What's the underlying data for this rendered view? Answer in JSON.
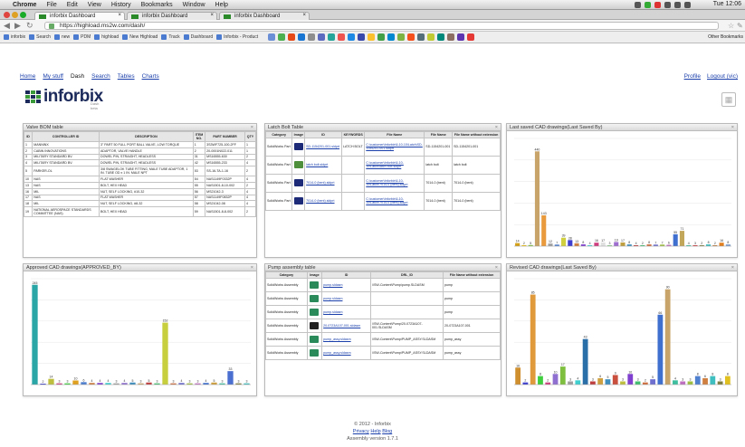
{
  "menubar": {
    "app": "Chrome",
    "items": [
      "File",
      "Edit",
      "View",
      "History",
      "Bookmarks",
      "Window",
      "Help"
    ],
    "clock": "Tue 12:06"
  },
  "tabs": [
    {
      "title": "inforbix Dashboard"
    },
    {
      "title": "inforbix Dashboard"
    },
    {
      "title": "inforbix Dashboard"
    }
  ],
  "address": {
    "url": "https://highload.ms2w.com/dash/"
  },
  "bookmarks": [
    {
      "label": "inforbix"
    },
    {
      "label": "Search"
    },
    {
      "label": "new"
    },
    {
      "label": "PDM"
    },
    {
      "label": "highload"
    },
    {
      "label": "New Highload"
    },
    {
      "label": "Track"
    },
    {
      "label": "Dashboard"
    },
    {
      "label": "Inforbix - Product"
    }
  ],
  "bookmarks_right": "Other Bookmarks",
  "nav": {
    "items": [
      "Home",
      "My stuff",
      "Dash",
      "Search",
      "Tables",
      "Charts"
    ],
    "current": 2,
    "right": [
      "Profile",
      "Logout (vic)"
    ]
  },
  "brand": {
    "name": "inforbix",
    "sub": "Dash beta"
  },
  "panels": {
    "valve": {
      "title": "Valve BOM table",
      "columns": [
        "ID",
        "CONTROLLER ID",
        "DESCRIPTION",
        "ITEM NO.",
        "PART NUMBER",
        "QTY"
      ],
      "rows": [
        [
          "1",
          "MANNINX",
          "3\" PART 50 FULL PORT BALL VALVE, LOW TORQUE",
          "1",
          "3S3WF725-100-2FF",
          "1"
        ],
        [
          "2",
          "CABIN INNOVATIONS",
          "ADAPTOR, VALVE HANDLE",
          "2",
          "20-0001N022-011",
          "1"
        ],
        [
          "3",
          "MILITARY STANDARD BV.",
          "DOWEL PIN, STRAIGHT, HEADLESS",
          "31",
          "MS16555-630",
          "2"
        ],
        [
          "4",
          "MILITARY STANDARD BV.",
          "DOWEL PIN, STRAIGHT, HEADLESS",
          "42",
          "MS16555-233",
          "4"
        ],
        [
          "5",
          "PARKER-OL",
          "3/8 SWAGELOK TUBE FITTING, MALE TUBE ADAPTOR, 1 IN. TUBE OD x 1 IN. MALE NPT",
          "53",
          "SS-16-TA-1-16",
          "2"
        ],
        [
          "10",
          "NAS",
          "FLAT WASHER",
          "54",
          "NAS1149F0332P",
          "4"
        ],
        [
          "13",
          "NAS",
          "BOLT, HEX HEAD",
          "55",
          "NAS1501-8-10-002",
          "2"
        ],
        [
          "16",
          "MIL",
          "NUT, SELF LOCKING, #10-32",
          "56",
          "MS21042-3",
          "4"
        ],
        [
          "17",
          "NAS",
          "FLAT WASHER",
          "57",
          "NAS1149F0832P",
          "4"
        ],
        [
          "18",
          "MIL",
          "NUT, SELF LOCKING, #8-32",
          "58",
          "MS21042-08",
          "4"
        ],
        [
          "19",
          "NATIONAL AEROSPACE STANDARDS COMMITTEE (NAS)",
          "BOLT, HEX HEAD",
          "59",
          "NAS1501-8-8-002",
          "2"
        ]
      ]
    },
    "latch": {
      "title": "Latch Bolt Table",
      "columns": [
        "Category",
        "Image",
        "ID",
        "KEYWORDS",
        "File Name",
        "File Name",
        "File Name without extension"
      ],
      "rows": [
        [
          "SolidWorks Part",
          "latch-bolt",
          "SD-1154201-001.sldprt",
          "LATCH BOLT",
          "C:\\customer\\Inforbix\\6-10-10\\Latch\\SD-1154201-001.sldprt",
          "SD-1154201-001",
          "SD-1154201-001"
        ],
        [
          "SolidWorks Part",
          "latch-bolt",
          "latch bolt.sldprt",
          "",
          "C:\\customer\\Inforbix\\6-10-10\\Latch\\latch bolt.sldprt",
          "latch bolt",
          "latch bolt"
        ],
        [
          "SolidWorks Part",
          "latch-bolt",
          "7014-0 (bent).sldprt",
          "",
          "C:\\customer\\Inforbix\\6-10-10\\Latch\\7014-0 (bent).sldprt",
          "7014-0 (bent)",
          "7014-0 (bent)"
        ],
        [
          "SolidWorks Part",
          "latch-bolt",
          "7014-0 (bent).sldprt",
          "",
          "C:\\customer\\Inforbix\\6-10-10\\Latch\\7014-0 (bent).sldprt",
          "7014-0 (bent)",
          "7014-0 (bent)"
        ]
      ]
    },
    "lastSaved": {
      "title": "Last saved CAD drawings(Last Saved By)"
    },
    "approved": {
      "title": "Approved CAD drawings(APPROVED_BY)"
    },
    "pump": {
      "title": "Pump assembly table",
      "columns": [
        "Category",
        "Image",
        "ID",
        "DRL_ID",
        "File Name without extension"
      ],
      "rows": [
        [
          "SolidWorks Assembly",
          "assembly",
          "pump.sldasm",
          "\\\\SW-Content\\Pump\\pump.SLDASM",
          "pump"
        ],
        [
          "SolidWorks Assembly",
          "assembly",
          "pump.sldasm",
          "",
          "pump"
        ],
        [
          "SolidWorks Assembly",
          "assembly",
          "pump.sldasm",
          "",
          "pump"
        ],
        [
          "SolidWorks Assembly",
          "assembly",
          "20-0723A107-001.sldasm",
          "\\\\SW-Content\\Pump\\20-0723A107-001.SLDASM",
          "20-0723A107-001"
        ],
        [
          "SolidWorks Assembly",
          "assembly",
          "pump_assy.sldasm",
          "\\\\SW-Content\\Pump\\PUMP_ASSY.SLDASM",
          "pump_assy"
        ],
        [
          "SolidWorks Assembly",
          "assembly",
          "pump_assy.sldasm",
          "\\\\SW-Content\\Pump\\PUMP_ASSY.SLDASM",
          "pump_assy"
        ]
      ]
    },
    "revised": {
      "title": "Revised CAD drawings(Last Saved By)"
    }
  },
  "footer": {
    "copyright": "© 2012 - Inforbix",
    "links": [
      "Privacy",
      "Help",
      "Blog"
    ],
    "version": "Assembly version 1.7.1"
  },
  "chart_data": [
    {
      "type": "bar",
      "title": "Last saved CAD drawings(Last Saved By)",
      "ylim": [
        0,
        500
      ],
      "values": [
        14,
        2,
        5,
        440,
        143,
        12,
        7,
        39,
        28,
        13,
        8,
        4,
        16,
        17,
        3,
        19,
        17,
        8,
        4,
        2,
        8,
        7,
        7,
        6,
        55,
        71,
        4,
        3,
        2,
        8,
        2,
        16,
        8
      ],
      "colors": [
        "#d4a017",
        "#f0c000",
        "#7fbf3f",
        "#c9a46a",
        "#e89a3c",
        "#a0a0a0",
        "#4f7fcf",
        "#cfcf3f",
        "#3f3fcf",
        "#cf7f3f",
        "#7f3fcf",
        "#3fcfcf",
        "#cf3f7f",
        "#e0e0e0",
        "#8fcf8f",
        "#9f6fcf",
        "#bf9f3f",
        "#3f8fbf",
        "#bf3f3f",
        "#3fbf6f",
        "#cf6f3f",
        "#6f6fcf",
        "#9fbf3f",
        "#bf6fbf",
        "#3f6fcf",
        "#c2a65a",
        "#3fbf9f",
        "#cf3f3f",
        "#7f7f3f",
        "#3fbfbf",
        "#bf7f3f",
        "#e08020",
        "#7f9fcf"
      ]
    },
    {
      "type": "bar",
      "title": "Approved CAD drawings(APPROVED_BY)",
      "ylim": [
        0,
        260
      ],
      "values": [
        245,
        2,
        14,
        3,
        3,
        10,
        6,
        4,
        4,
        4,
        3,
        4,
        5,
        3,
        5,
        3,
        152,
        3,
        4,
        3,
        3,
        4,
        5,
        3,
        33,
        3,
        3
      ],
      "colors": [
        "#2aa6a6",
        "#3f3fcf",
        "#bfbf3f",
        "#cf3f7f",
        "#3fcf3f",
        "#e0a020",
        "#4f7fcf",
        "#cf7f3f",
        "#7f3fcf",
        "#3fcfcf",
        "#a0a0a0",
        "#8f6fcf",
        "#3f8fbf",
        "#c9a46a",
        "#bf3f3f",
        "#3fbf6f",
        "#c8cf3f",
        "#cf6f3f",
        "#6f6fcf",
        "#9fbf3f",
        "#bf6fbf",
        "#3f6fcf",
        "#cfa03f",
        "#3fbf9f",
        "#4a6fd0",
        "#7f7f3f",
        "#3fbfbf"
      ]
    },
    {
      "type": "bar",
      "title": "Revised CAD drawings(Last Saved By)",
      "ylim": [
        0,
        100
      ],
      "values": [
        16,
        2,
        85,
        8,
        2,
        10,
        17,
        3,
        4,
        43,
        3,
        6,
        5,
        9,
        3,
        10,
        3,
        2,
        5,
        66,
        90,
        4,
        3,
        3,
        8,
        6,
        8,
        3,
        8
      ],
      "colors": [
        "#cf8f2f",
        "#3f3fcf",
        "#e09a3c",
        "#3fcf3f",
        "#cf3f7f",
        "#8f6fcf",
        "#7fbf3f",
        "#a0a0a0",
        "#3fcfcf",
        "#2a6fa8",
        "#bf3f3f",
        "#cfa03f",
        "#3f8fbf",
        "#c94f3f",
        "#bfbf3f",
        "#7f3fcf",
        "#3fbf6f",
        "#cf6f3f",
        "#6f6fcf",
        "#3f6fcf",
        "#c9a46a",
        "#3fbf9f",
        "#bf6fbf",
        "#9fbf3f",
        "#4f7fcf",
        "#cf7f3f",
        "#3fbfbf",
        "#7f7f3f",
        "#e0c020"
      ]
    }
  ]
}
